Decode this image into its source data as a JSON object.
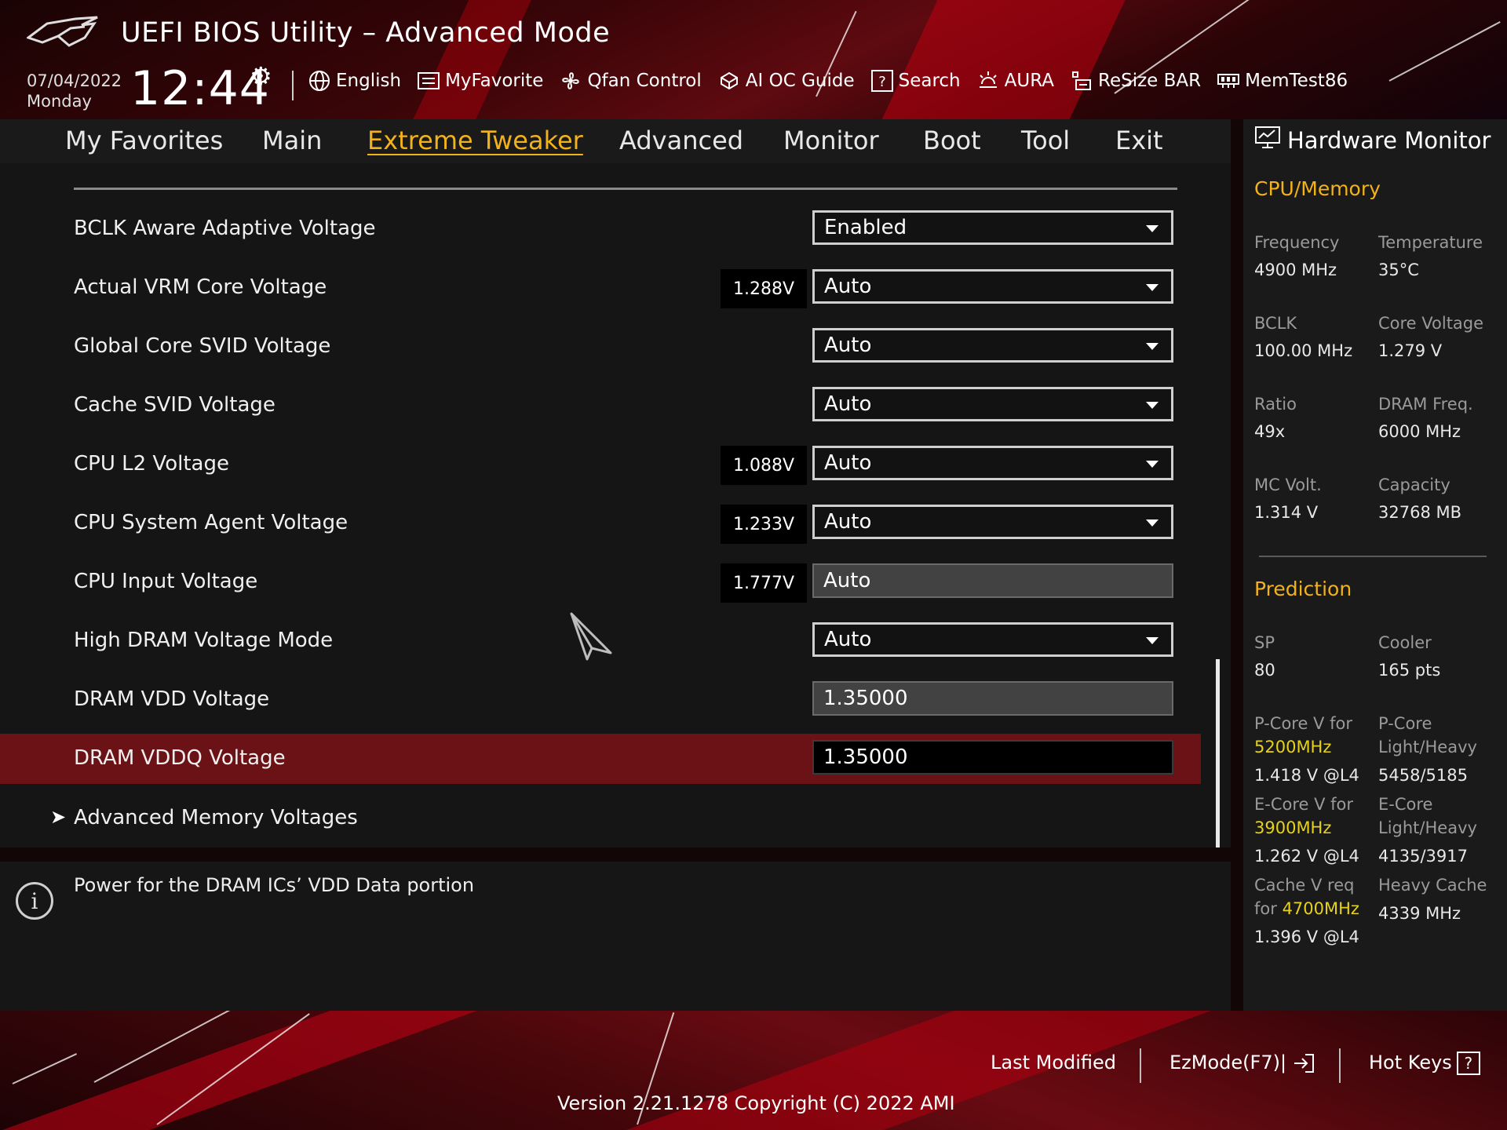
{
  "header": {
    "title": "UEFI BIOS Utility – Advanced Mode",
    "date": "07/04/2022",
    "weekday": "Monday",
    "time": "12:44",
    "toolbar": [
      {
        "label": "English",
        "icon": "globe-icon"
      },
      {
        "label": "MyFavorite",
        "icon": "favorite-list-icon"
      },
      {
        "label": "Qfan Control",
        "icon": "fan-icon"
      },
      {
        "label": "AI OC Guide",
        "icon": "ai-chip-icon"
      },
      {
        "label": "Search",
        "icon": "help-search-icon"
      },
      {
        "label": "AURA",
        "icon": "aura-light-icon"
      },
      {
        "label": "ReSize BAR",
        "icon": "resize-bar-icon"
      },
      {
        "label": "MemTest86",
        "icon": "memory-test-icon"
      }
    ]
  },
  "tabs": [
    {
      "label": "My Favorites",
      "active": false
    },
    {
      "label": "Main",
      "active": false
    },
    {
      "label": "Extreme Tweaker",
      "active": true
    },
    {
      "label": "Advanced",
      "active": false
    },
    {
      "label": "Monitor",
      "active": false
    },
    {
      "label": "Boot",
      "active": false
    },
    {
      "label": "Tool",
      "active": false
    },
    {
      "label": "Exit",
      "active": false
    }
  ],
  "settings": [
    {
      "label": "BCLK Aware Adaptive Voltage",
      "voltage": "",
      "value": "Enabled",
      "type": "dropdown"
    },
    {
      "label": "Actual VRM Core Voltage",
      "voltage": "1.288V",
      "value": "Auto",
      "type": "dropdown"
    },
    {
      "label": "Global Core SVID Voltage",
      "voltage": "",
      "value": "Auto",
      "type": "dropdown"
    },
    {
      "label": "Cache SVID Voltage",
      "voltage": "",
      "value": "Auto",
      "type": "dropdown"
    },
    {
      "label": "CPU L2 Voltage",
      "voltage": "1.088V",
      "value": "Auto",
      "type": "dropdown"
    },
    {
      "label": "CPU System Agent Voltage",
      "voltage": "1.233V",
      "value": "Auto",
      "type": "dropdown"
    },
    {
      "label": "CPU Input Voltage",
      "voltage": "1.777V",
      "value": "Auto",
      "type": "readonly"
    },
    {
      "label": "High DRAM Voltage Mode",
      "voltage": "",
      "value": "Auto",
      "type": "dropdown"
    },
    {
      "label": "DRAM VDD Voltage",
      "voltage": "",
      "value": "1.35000",
      "type": "readonly"
    },
    {
      "label": "DRAM VDDQ Voltage",
      "voltage": "",
      "value": "1.35000",
      "type": "input",
      "selected": true
    }
  ],
  "submenu": {
    "label": "Advanced Memory Voltages"
  },
  "info": {
    "text": "Power for the DRAM ICs’ VDD Data portion"
  },
  "hardware_monitor": {
    "title": "Hardware Monitor",
    "cpu_memory": {
      "heading": "CPU/Memory",
      "frequency_label": "Frequency",
      "frequency": "4900 MHz",
      "temperature_label": "Temperature",
      "temperature": "35°C",
      "bclk_label": "BCLK",
      "bclk": "100.00 MHz",
      "core_voltage_label": "Core Voltage",
      "core_voltage": "1.279 V",
      "ratio_label": "Ratio",
      "ratio": "49x",
      "dram_freq_label": "DRAM Freq.",
      "dram_freq": "6000 MHz",
      "mc_volt_label": "MC Volt.",
      "mc_volt": "1.314 V",
      "capacity_label": "Capacity",
      "capacity": "32768 MB"
    },
    "prediction": {
      "heading": "Prediction",
      "sp_label": "SP",
      "sp": "80",
      "cooler_label": "Cooler",
      "cooler": "165 pts",
      "pcore_v_label": "P-Core V for",
      "pcore_freq": "5200MHz",
      "pcore_v": "1.418 V @L4",
      "pcore_lh_label_1": "P-Core",
      "pcore_lh_label_2": "Light/Heavy",
      "pcore_lh": "5458/5185",
      "ecore_v_label": "E-Core V for",
      "ecore_freq": "3900MHz",
      "ecore_v": "1.262 V @L4",
      "ecore_lh_label_1": "E-Core",
      "ecore_lh_label_2": "Light/Heavy",
      "ecore_lh": "4135/3917",
      "cache_v_label_1": "Cache V req",
      "cache_v_label_2": "for",
      "cache_freq": "4700MHz",
      "cache_v": "1.396 V @L4",
      "heavy_cache_label": "Heavy Cache",
      "heavy_cache": "4339 MHz"
    }
  },
  "footer": {
    "last_modified": "Last Modified",
    "ezmode": "EzMode(F7)|",
    "hot_keys": "Hot Keys",
    "hot_keys_key": "?",
    "version": "Version 2.21.1278 Copyright (C) 2022 AMI"
  },
  "colors": {
    "accent": "#f2b21a",
    "selected_row": "#6a1216",
    "background": "#151515"
  }
}
